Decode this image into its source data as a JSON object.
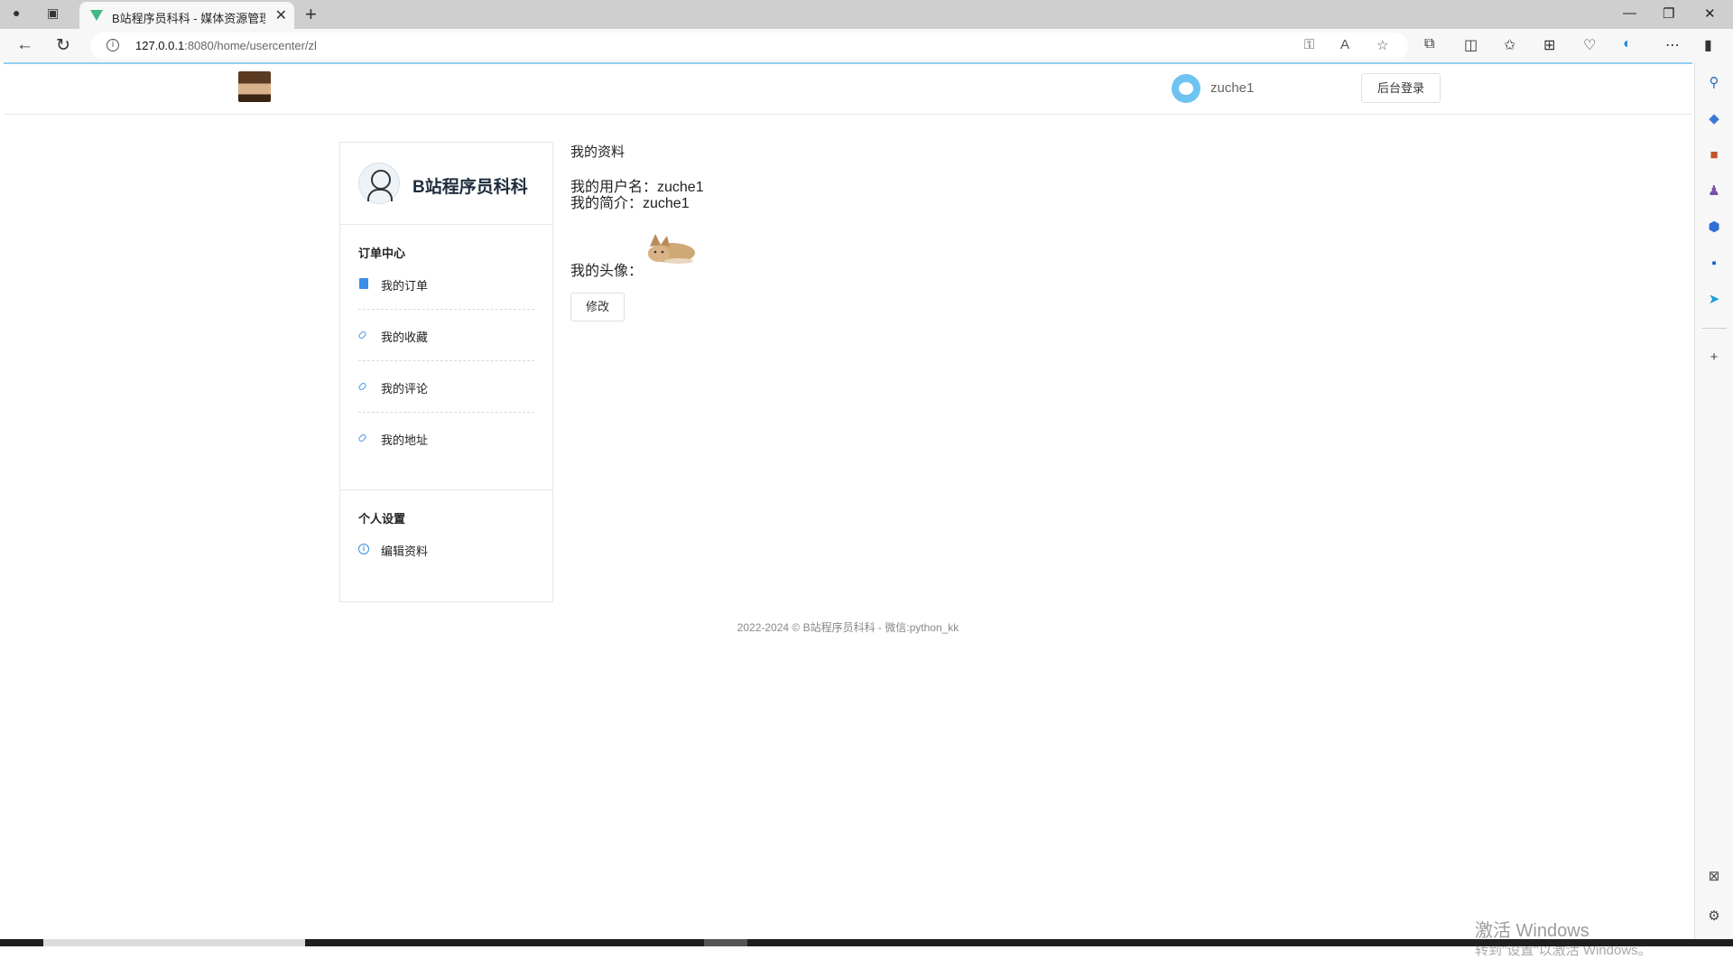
{
  "browser": {
    "tab_title": "B站程序员科科 - 媒体资源管理系",
    "url_host": "127.0.0.1",
    "url_rest": ":8080/home/usercenter/zl"
  },
  "header": {
    "username": "zuche1",
    "admin_login": "后台登录"
  },
  "sidebar_panel": {
    "brand": "B站程序员科科",
    "order_center": {
      "title": "订单中心",
      "items": [
        {
          "label": "我的订单",
          "icon": "document-icon"
        },
        {
          "label": "我的收藏",
          "icon": "link-icon"
        },
        {
          "label": "我的评论",
          "icon": "link-icon"
        },
        {
          "label": "我的地址",
          "icon": "link-icon"
        }
      ]
    },
    "personal_settings": {
      "title": "个人设置",
      "items": [
        {
          "label": "编辑资料",
          "icon": "info-icon"
        }
      ]
    }
  },
  "profile": {
    "title": "我的资料",
    "username_line": "我的用户名：zuche1",
    "bio_line": "我的简介：zuche1",
    "avatar_label": "我的头像：",
    "edit_button": "修改"
  },
  "footer": "2022-2024 © B站程序员科科 - 微信:python_kk",
  "watermark": {
    "line1": "激活 Windows",
    "line2": "转到\"设置\"以激活 Windows。"
  },
  "colors": {
    "accent": "#3a8ee6",
    "top_border": "#8fd1f3",
    "vue_green": "#41b883"
  }
}
